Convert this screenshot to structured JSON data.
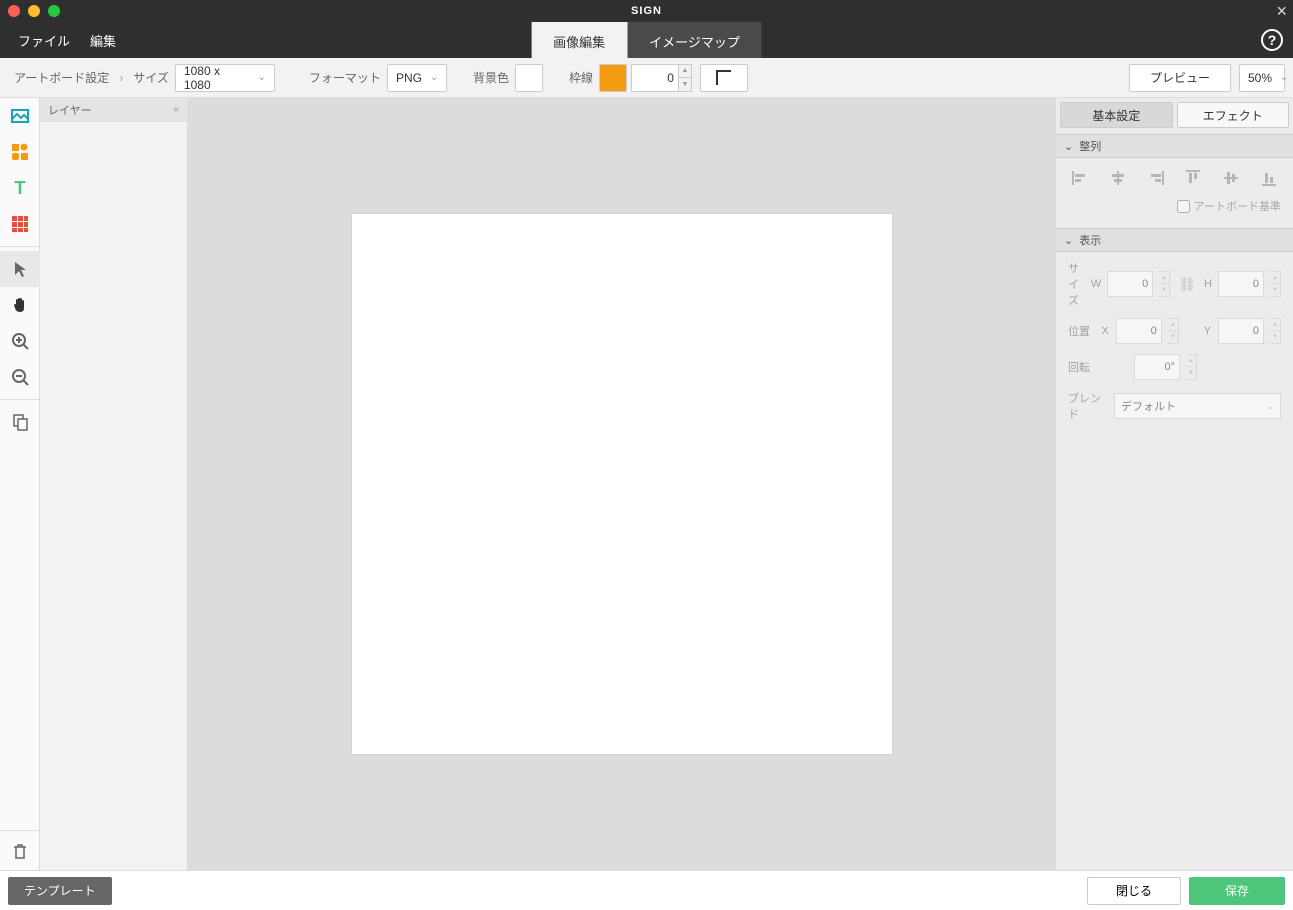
{
  "app_title": "SIGN",
  "menus": {
    "file": "ファイル",
    "edit": "編集"
  },
  "mode_tabs": {
    "image_edit": "画像編集",
    "image_map": "イメージマップ"
  },
  "toolbar": {
    "artboard_settings": "アートボード設定",
    "size_label": "サイズ",
    "size_value": "1080 x 1080",
    "format_label": "フォーマット",
    "format_value": "PNG",
    "bg_label": "背景色",
    "bg_color": "#ffffff",
    "border_label": "枠線",
    "border_color": "#f39c12",
    "border_width": "0",
    "preview": "プレビュー",
    "zoom": "50%"
  },
  "layers": {
    "header": "レイヤー"
  },
  "props": {
    "tab_basic": "基本設定",
    "tab_effect": "エフェクト",
    "section_align": "整列",
    "artboard_ref": "アートボード基準",
    "section_display": "表示",
    "size_label": "サイズ",
    "w_label": "W",
    "w_value": "0",
    "h_label": "H",
    "h_value": "0",
    "pos_label": "位置",
    "x_label": "X",
    "x_value": "0",
    "y_label": "Y",
    "y_value": "0",
    "rotation_label": "回転",
    "rotation_value": "0°",
    "blend_label": "ブレンド",
    "blend_value": "デフォルト"
  },
  "footer": {
    "template": "テンプレート",
    "close": "閉じる",
    "save": "保存"
  }
}
